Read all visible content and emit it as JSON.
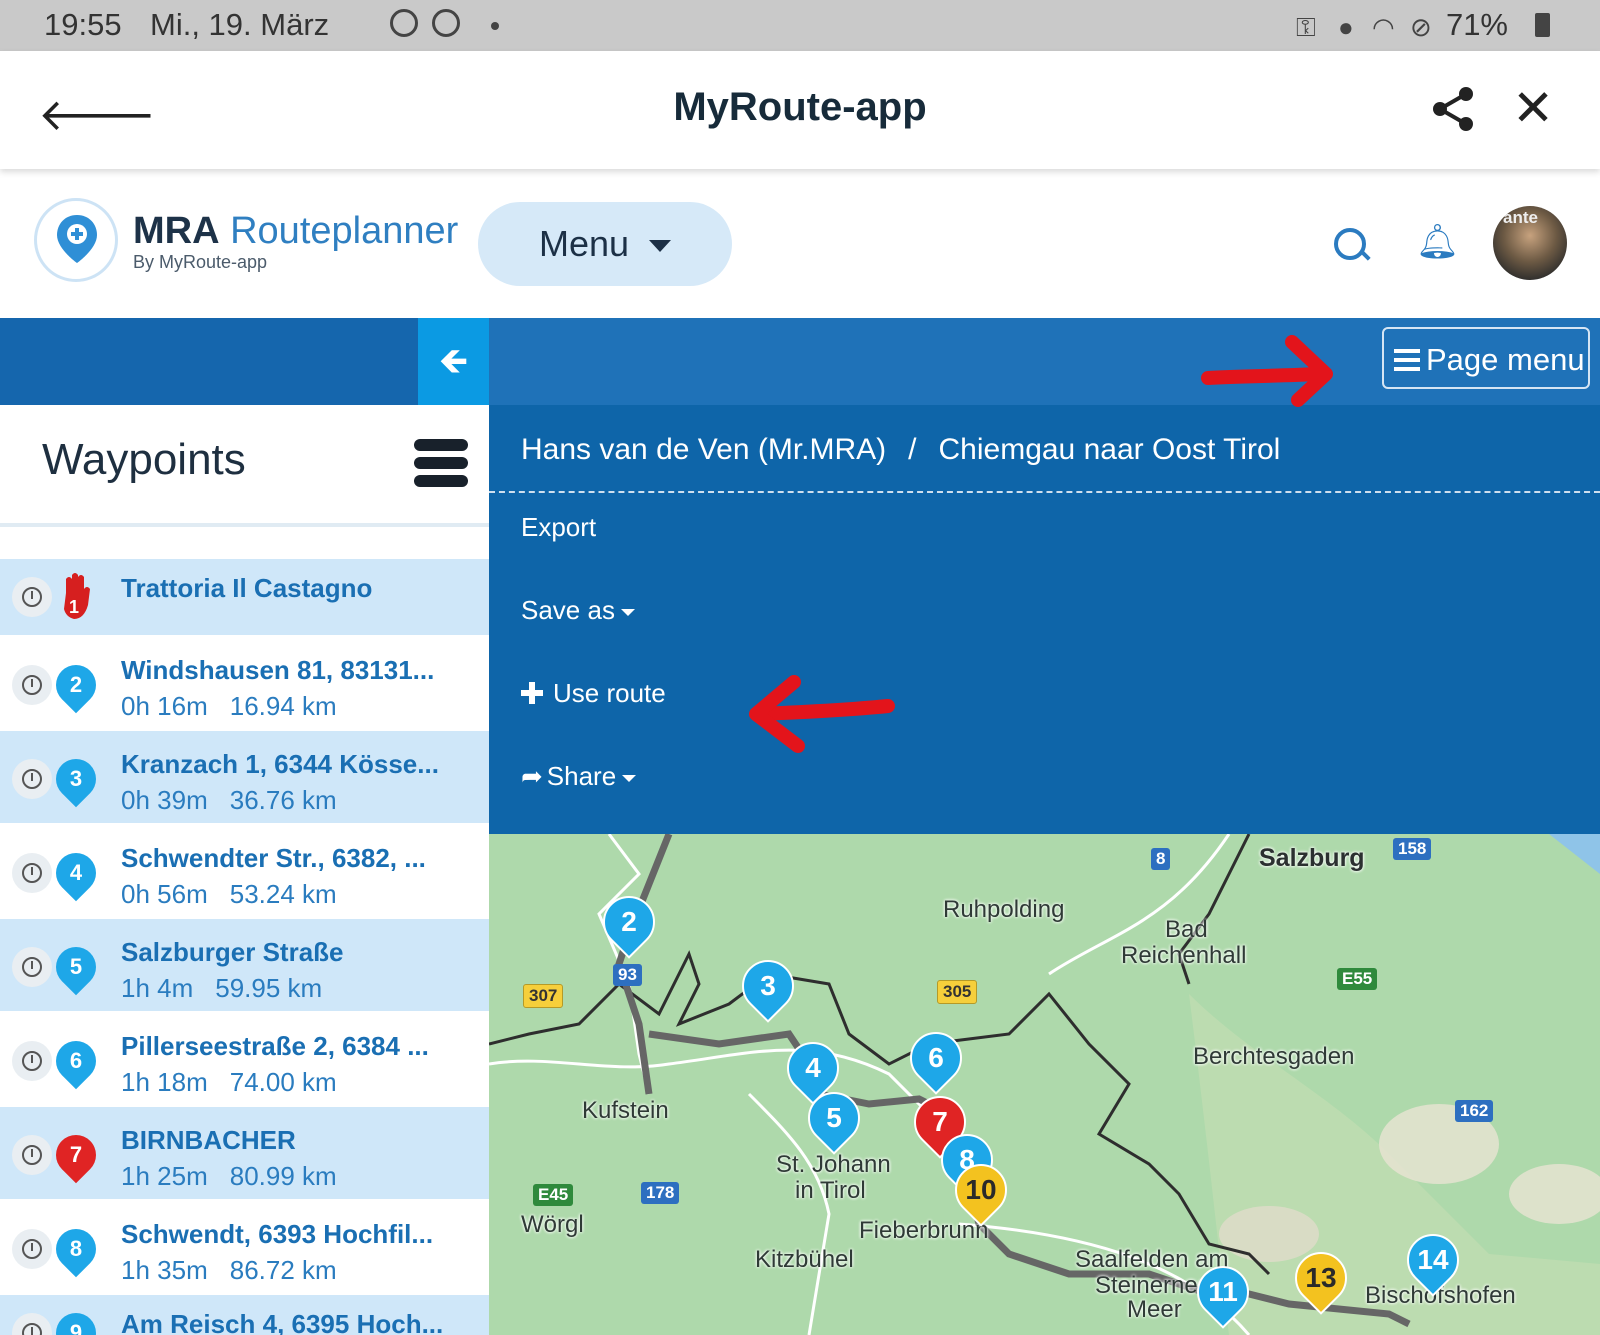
{
  "status_bar": {
    "time": "19:55",
    "date": "Mi., 19. März",
    "battery": "71%"
  },
  "app_bar": {
    "title": "MyRoute-app"
  },
  "header": {
    "logo_brand": "MRA",
    "logo_product": "Routeplanner",
    "logo_tagline": "By MyRoute-app",
    "menu_label": "Menu",
    "avatar_text": "ante"
  },
  "toolbar": {
    "page_menu_label": "Page menu"
  },
  "sidebar": {
    "title": "Waypoints",
    "waypoints": [
      {
        "number": "1",
        "name": "Trattoria Il Castagno",
        "time": "",
        "distance": "",
        "color": "#e02424",
        "type": "start"
      },
      {
        "number": "2",
        "name": "Windshausen 81, 83131...",
        "time": "0h 16m",
        "distance": "16.94 km",
        "color": "#1ea7e8"
      },
      {
        "number": "3",
        "name": "Kranzach 1, 6344 Kösse...",
        "time": "0h 39m",
        "distance": "36.76 km",
        "color": "#1ea7e8"
      },
      {
        "number": "4",
        "name": "Schwendter Str., 6382, ...",
        "time": "0h 56m",
        "distance": "53.24 km",
        "color": "#1ea7e8"
      },
      {
        "number": "5",
        "name": "Salzburger Straße",
        "time": "1h 4m",
        "distance": "59.95 km",
        "color": "#1ea7e8"
      },
      {
        "number": "6",
        "name": "Pillerseestraße 2, 6384 ...",
        "time": "1h 18m",
        "distance": "74.00 km",
        "color": "#1ea7e8"
      },
      {
        "number": "7",
        "name": "BIRNBACHER",
        "time": "1h 25m",
        "distance": "80.99 km",
        "color": "#e02424"
      },
      {
        "number": "8",
        "name": "Schwendt, 6393 Hochfil...",
        "time": "1h 35m",
        "distance": "86.72 km",
        "color": "#1ea7e8"
      },
      {
        "number": "9",
        "name": "Am Reisch 4, 6395 Hoch...",
        "time": "",
        "distance": "",
        "color": "#1ea7e8"
      }
    ]
  },
  "page_menu": {
    "breadcrumb_user": "Hans van de Ven (Mr.MRA)",
    "breadcrumb_separator": "/",
    "breadcrumb_route": "Chiemgau naar Oost Tirol",
    "items": {
      "export": "Export",
      "save_as": "Save as",
      "use_route": "Use route",
      "share": "Share"
    }
  },
  "map": {
    "places": {
      "salzburg": "Salzburg",
      "ruhpolding": "Ruhpolding",
      "bad_reichenhall_1": "Bad",
      "bad_reichenhall_2": "Reichenhall",
      "berchtesgaden": "Berchtesgaden",
      "kufstein": "Kufstein",
      "st_johann_1": "St. Johann",
      "st_johann_2": "in Tirol",
      "woergl": "Wörgl",
      "fieberbrunn": "Fieberbrunn",
      "kitzbuehel": "Kitzbühel",
      "saalfelden_1": "Saalfelden am",
      "saalfelden_2": "Steinernes",
      "saalfelden_3": "Meer",
      "bischofshofen": "Bischofshofen"
    },
    "roads": {
      "r307": "307",
      "r305": "305",
      "r93": "93",
      "r178": "178",
      "r8": "8",
      "r158": "158",
      "r162": "162",
      "e45": "E45",
      "e55": "E55"
    },
    "markers": [
      "2",
      "3",
      "4",
      "5",
      "6",
      "7",
      "8",
      "10",
      "11",
      "13",
      "14"
    ]
  },
  "colors": {
    "primary_blue": "#0e65a9",
    "marker_blue": "#1ea7e8",
    "marker_red": "#e02424",
    "marker_yellow": "#f3c21f",
    "annotation_red": "#e3141b"
  }
}
